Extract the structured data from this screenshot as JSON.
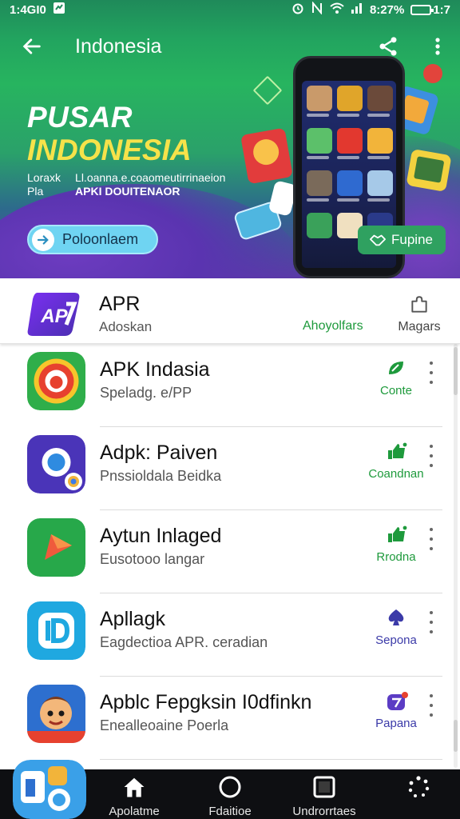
{
  "status_bar": {
    "time": "1:4GI0",
    "battery": "1:7",
    "signal_text": "8:27%"
  },
  "app_bar": {
    "title": "Indonesia",
    "back_icon": "arrow-left-icon",
    "share_icon": "share-icon",
    "more_icon": "more-vert-icon"
  },
  "banner": {
    "title_line1": "PUSAR",
    "title_line2": "INDONESIA",
    "sub_left_1": "Loraxk",
    "sub_left_2": "Pla",
    "sub_right_1": "Ll.oanna.e.coaomeutirrinaeion",
    "sub_right_2": "APKI DOUITENAOR",
    "left_button": "Poloonlaem",
    "right_button": "Fupine"
  },
  "featured": {
    "name": "APR",
    "subtitle": "Adoskan",
    "link": "Ahoyolfars",
    "manage_label": "Magars"
  },
  "apps": [
    {
      "name": "APK Indasia",
      "subtitle": "Speladg. e/PP",
      "action": "Conte",
      "action_color": "#1e9a3c"
    },
    {
      "name": "Adpk: Paiven",
      "subtitle": "Pnssioldala Beidka",
      "action": "Coandnan",
      "action_color": "#1e9a3c"
    },
    {
      "name": "Aytun Inlaged",
      "subtitle": "Eusotooo langar",
      "action": "Rrodna",
      "action_color": "#1e9a3c"
    },
    {
      "name": "Apllagk",
      "subtitle": "Eagdectioa APR. ceradian",
      "action": "Sepona",
      "action_color": "#3b3aa8"
    },
    {
      "name": "Apblc Fepgksin I0dfinkn",
      "subtitle": "Enealleoaine Poerla",
      "action": "Papana",
      "action_color": "#3b3aa8"
    }
  ],
  "bottom_nav": [
    {
      "label": "Apolatme",
      "icon": "home-icon"
    },
    {
      "label": "Fdaitioe",
      "icon": "circle-icon"
    },
    {
      "label": "Undrorrtaes",
      "icon": "square-icon"
    },
    {
      "label": "",
      "icon": "loading-icon"
    }
  ],
  "colors": {
    "accent_green": "#1e9a3c",
    "accent_purple": "#3b3aa8",
    "banner_yellow": "#f6e24a"
  }
}
